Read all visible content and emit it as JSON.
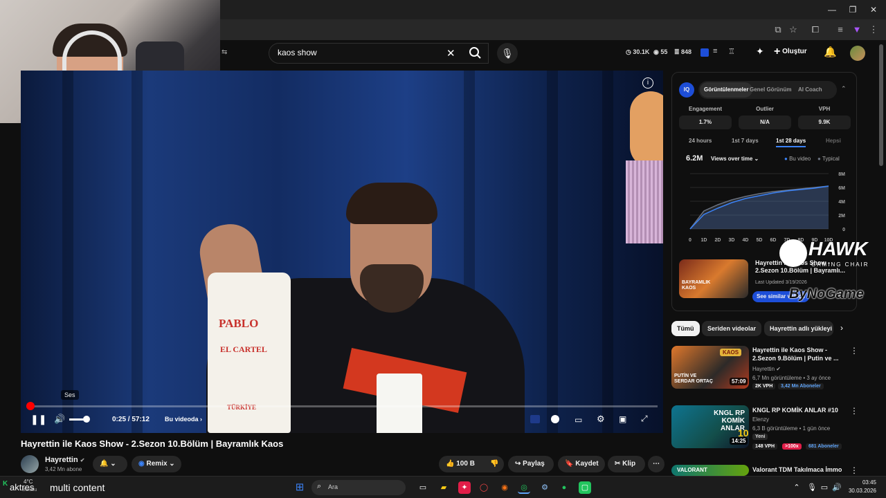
{
  "window": {
    "minimize": "—",
    "restore": "❐",
    "close": "✕"
  },
  "webcam": {},
  "yt_header": {
    "search_value": "kaos show",
    "stats": {
      "views": "30.1K",
      "likes": "55",
      "comments": "848"
    },
    "create_label": "Oluştur"
  },
  "player": {
    "sound_tooltip": "Ses",
    "time": "0:25 / 57:12",
    "chapter_label": "Bu videoda",
    "progress": 0.007,
    "volume": 0.7,
    "bag_brand": "PABLO",
    "bag_sub": "EL CARTEL",
    "bag_bottom": "TÜRKİYE"
  },
  "video": {
    "title": "Hayrettin ile Kaos Show - 2.Sezon 10.Bölüm | Bayramlık Kaos",
    "channel": "Hayrettin",
    "subscribers": "3,42 Mn abone",
    "remix": "Remix",
    "likes": "100 B",
    "share": "Paylaş",
    "save": "Kaydet",
    "clip": "Klip"
  },
  "iq_panel": {
    "logo": "IQ",
    "tabs": [
      "Görüntülenmeler",
      "Genel Görünüm",
      "AI Coach"
    ],
    "metrics": [
      {
        "label": "Engagement",
        "value": "1.7%"
      },
      {
        "label": "Outlier",
        "value": "N/A"
      },
      {
        "label": "VPH",
        "value": "9.9K"
      }
    ],
    "ranges": [
      "24 hours",
      "1st 7 days",
      "1st 28 days",
      "Hepsi"
    ],
    "total_views": "6.2M",
    "views_selector": "Views over time",
    "legend": [
      "Bu video",
      "Typical"
    ],
    "card_title": "Hayrettin ile Kaos Show - 2.Sezon 10.Bölüm | Bayramlı...",
    "card_updated": "Last Updated 3/19/2026",
    "card_button": "See similar videos",
    "thumb_text": "BAYRAMLIK KAOS"
  },
  "chart_data": {
    "type": "area",
    "x": [
      "0",
      "1D",
      "2D",
      "3D",
      "4D",
      "5D",
      "6D",
      "7D",
      "8D",
      "9D",
      "10D"
    ],
    "series": [
      {
        "name": "Bu video",
        "values": [
          0,
          2.1,
          3.0,
          3.8,
          4.4,
          4.8,
          5.2,
          5.5,
          5.7,
          5.9,
          6.2
        ]
      },
      {
        "name": "Typical",
        "values": [
          0,
          2.6,
          3.5,
          4.2,
          4.7,
          5.1,
          5.4,
          5.6,
          5.8,
          6.0,
          6.2
        ]
      }
    ],
    "yticks": [
      "8M",
      "6M",
      "4M",
      "2M",
      "0"
    ],
    "ylim": [
      0,
      8
    ],
    "colors": {
      "Bu video": "#3b82f6",
      "Typical": "#6b7280"
    }
  },
  "overlay": {
    "brand": "HAWK",
    "brand_sub": "GAMING CHAIR",
    "sponsor": "ByNoGame"
  },
  "chips": [
    "Tümü",
    "Seriden videolar",
    "Hayrettin adlı yükleyi"
  ],
  "recommendations": [
    {
      "title": "Hayrettin ile Kaos Show - 2.Sezon 9.Bölüm | Putin ve ...",
      "channel": "Hayrettin",
      "meta": "6,7 Mn görüntüleme • 3 ay önce",
      "duration": "57:09",
      "thumb_text": "PUTİN VE SERDAR ORTAÇ",
      "thumb_badge": "KAOS",
      "badges": [
        "2K VPH",
        "3,42 Mn Aboneler"
      ]
    },
    {
      "title": "KNGL RP KOMİK ANLAR #10",
      "channel": "Elenzy",
      "meta": "6,3 B görüntüleme • 1 gün önce",
      "new": "Yeni",
      "duration": "14:25",
      "thumb_text": "KNGL RP KOMİK ANLAR",
      "thumb_num": "10",
      "badges": [
        "148 VPH",
        ">100x",
        "681 Aboneler"
      ]
    },
    {
      "title": "Valorant TDM Takılmaca İmmo",
      "thumb_text": "VALORANT"
    }
  ],
  "taskbar": {
    "weather_temp": "4°C",
    "weather_desc": "Bulutlu",
    "stream_title": "multi content",
    "stream_prefix": "aktres",
    "search_label": "Ara",
    "time": "03:45",
    "date": "30.03.2026"
  }
}
